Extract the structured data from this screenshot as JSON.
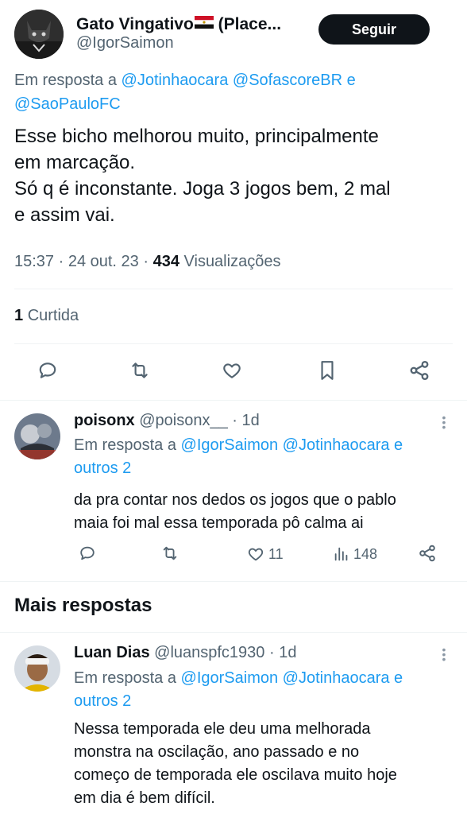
{
  "main_tweet": {
    "author_name": "Gato Vingativo",
    "author_name_suffix": " (Place...",
    "author_handle": "@IgorSaimon",
    "follow_label": "Seguir",
    "reply_prefix": "Em resposta a",
    "reply_mentions_line1": "@Jotinhaocara @SofascoreBR e",
    "reply_mentions_line2": "@SaoPauloFC",
    "text_line1": "Esse bicho melhorou muito, principalmente",
    "text_line2": "em marcação.",
    "text_line3": "Só q é inconstante. Joga 3 jogos bem, 2 mal",
    "text_line4": "e assim vai.",
    "time": "15:37 · 24 out. 23 ·",
    "views_count": "434",
    "views_label": "Visualizações",
    "likes_count": "1",
    "likes_label": "Curtida"
  },
  "replies": [
    {
      "name": "poisonx",
      "handle": "@poisonx__ · 1d",
      "reply_prefix": "Em resposta a",
      "mentions": "@IgorSaimon @Jotinhaocara e",
      "mentions_line2": "outros 2",
      "text_line1": "da pra contar nos dedos os jogos que o pablo",
      "text_line2": "maia foi mal essa temporada pô calma ai",
      "likes": "11",
      "views": "148"
    },
    {
      "name": "Luan Dias",
      "handle": "@luanspfc1930 · 1d",
      "reply_prefix": "Em resposta a",
      "mentions": "@IgorSaimon @Jotinhaocara e",
      "mentions_line2": "outros 2",
      "text_line1": "Nessa temporada ele deu uma melhorada",
      "text_line2": "monstra na oscilação, ano passado e no",
      "text_line3": "começo de temporada ele oscilava muito hoje",
      "text_line4": "em dia é bem difícil."
    }
  ],
  "section_title": "Mais respostas",
  "colors": {
    "accent": "#1d9bf0",
    "secondary_text": "#536471",
    "primary_text": "#0f1419",
    "follow_button_bg": "#0f1419"
  },
  "icons": [
    "reply-icon",
    "retweet-icon",
    "like-icon",
    "bookmark-icon",
    "share-icon",
    "views-icon",
    "more-icon"
  ]
}
